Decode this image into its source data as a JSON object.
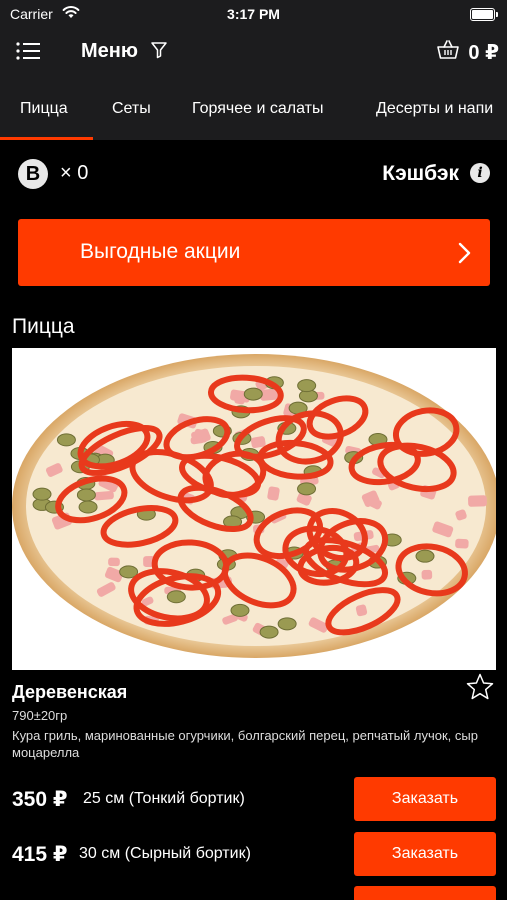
{
  "status_bar": {
    "carrier": "Carrier",
    "time": "3:17 PM"
  },
  "navbar": {
    "title": "Меню",
    "cart_total": "0 ₽"
  },
  "tabs": [
    "Пицца",
    "Сеты",
    "Горячее и салаты",
    "Десерты и напи"
  ],
  "bonus": {
    "icon_letter": "B",
    "count": "× 0",
    "cashback_label": "Кэшбэк",
    "info_glyph": "i"
  },
  "promo": {
    "label": "Выгодные акции"
  },
  "section": {
    "title": "Пицца"
  },
  "product": {
    "name": "Деревенская",
    "weight": "790±20гр",
    "description": "Кура гриль, маринованные огурчики, болгарский перец, репчатый лучок, сыр моцарелла",
    "options": [
      {
        "price": "350 ₽",
        "size": "25 см (Тонкий бортик)",
        "button": "Заказать"
      },
      {
        "price": "415 ₽",
        "size": "30 см (Сырный бортик)",
        "button": "Заказать"
      },
      {
        "price": "",
        "size": "",
        "button": ""
      }
    ]
  },
  "colors": {
    "accent": "#ff3a00",
    "bar_bg": "#1c1c1e",
    "page_bg": "#000000"
  },
  "icons": [
    "wifi-icon",
    "battery-icon",
    "menu-list-icon",
    "filter-icon",
    "basket-icon",
    "bonus-b-icon",
    "info-icon",
    "chevron-right-icon",
    "star-outline-icon"
  ]
}
